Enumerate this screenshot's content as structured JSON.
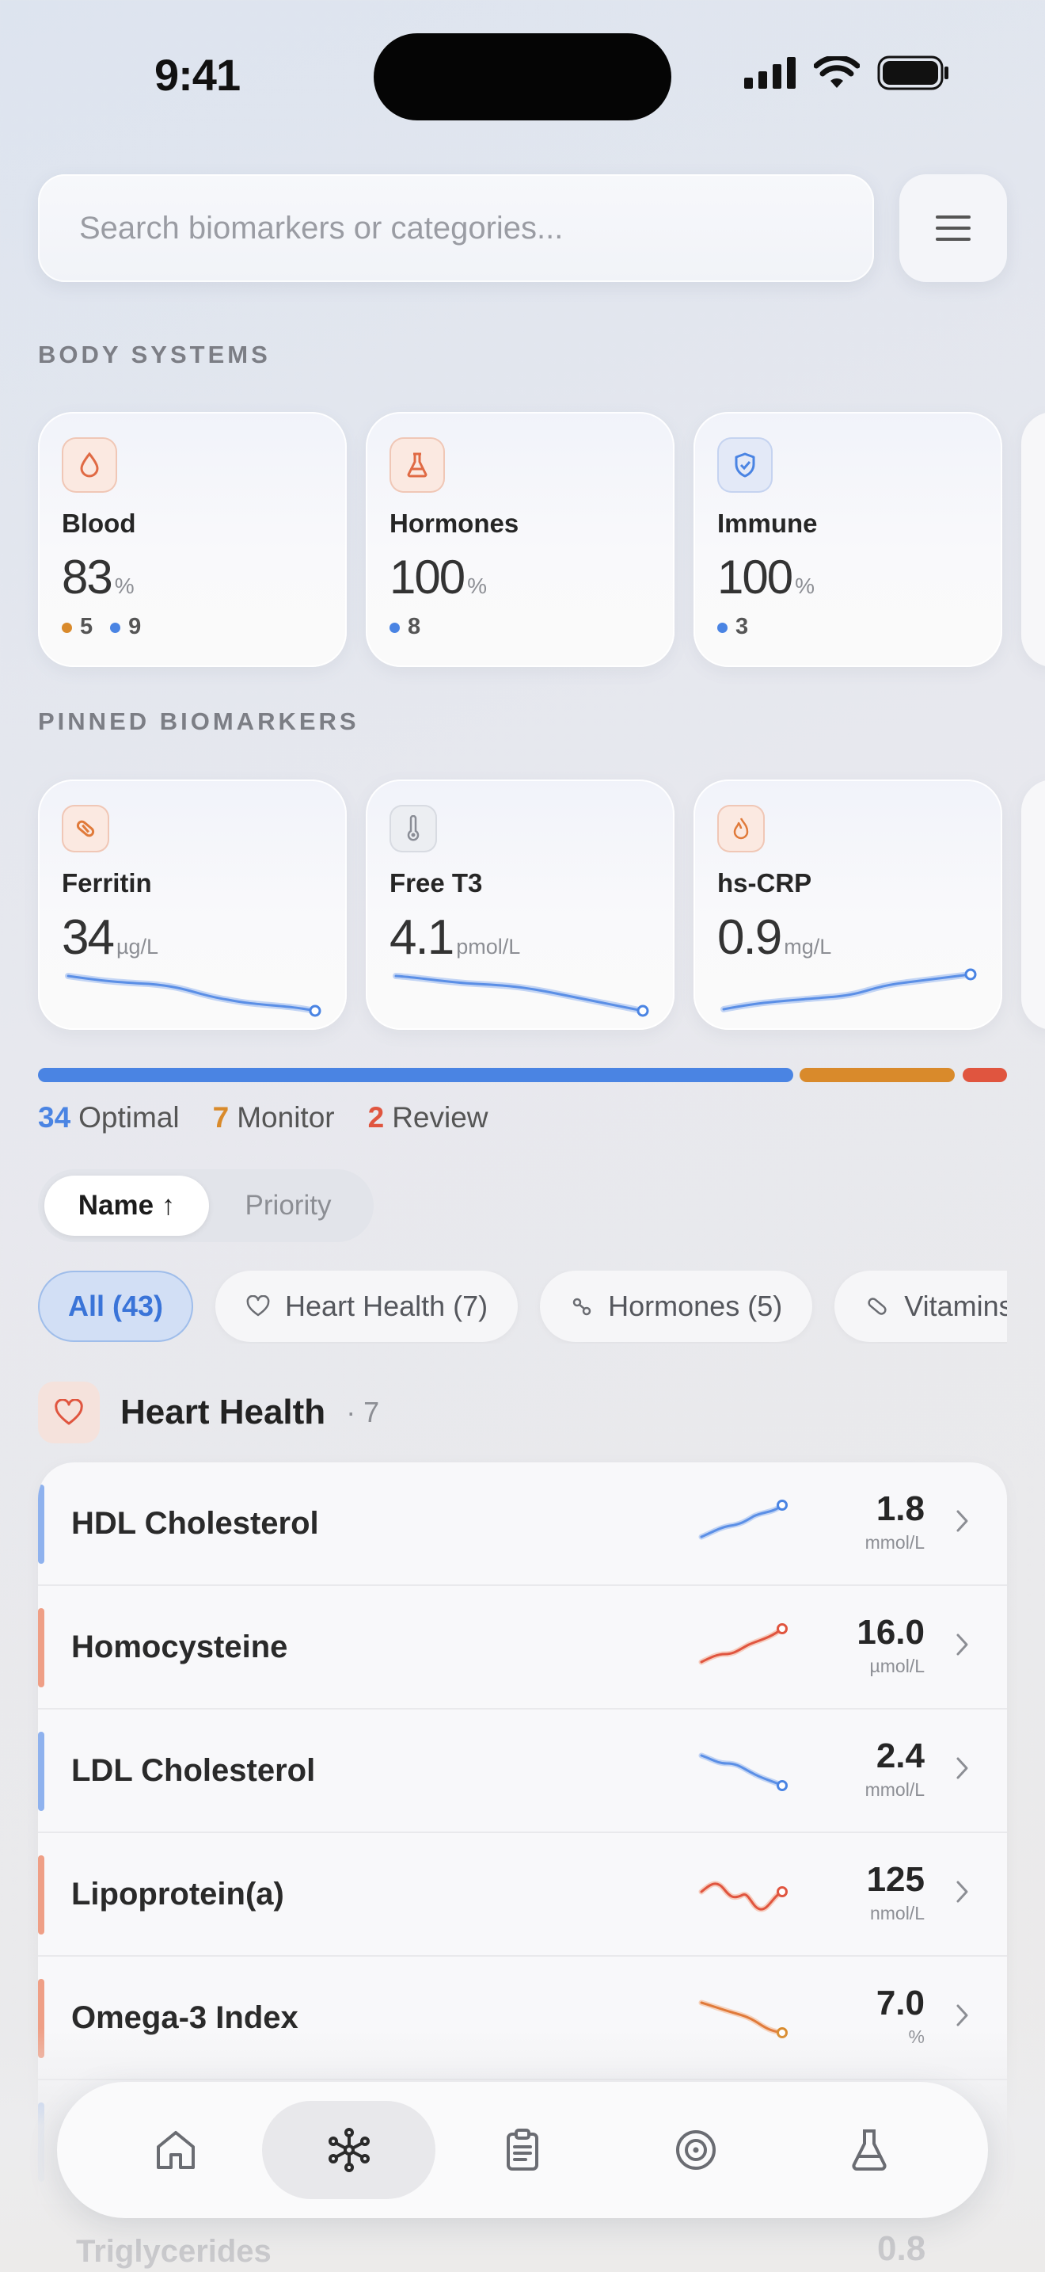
{
  "status_bar": {
    "time": "9:41"
  },
  "search": {
    "placeholder": "Search biomarkers or categories..."
  },
  "body_systems": {
    "label": "BODY SYSTEMS",
    "cards": [
      {
        "name": "Blood",
        "value": "83",
        "unit": "%",
        "icon": "drop-icon",
        "counts": [
          {
            "color": "#d98a2b",
            "value": "5"
          },
          {
            "color": "#4a84e3",
            "value": "9"
          }
        ]
      },
      {
        "name": "Hormones",
        "value": "100",
        "unit": "%",
        "icon": "flask-icon",
        "counts": [
          {
            "color": "#4a84e3",
            "value": "8"
          }
        ]
      },
      {
        "name": "Immune",
        "value": "100",
        "unit": "%",
        "icon": "shield-icon",
        "counts": [
          {
            "color": "#4a84e3",
            "value": "3"
          }
        ]
      }
    ]
  },
  "pinned": {
    "label": "PINNED BIOMARKERS",
    "cards": [
      {
        "name": "Ferritin",
        "value": "34",
        "unit": "µg/L",
        "icon": "pill-icon",
        "trend": "down"
      },
      {
        "name": "Free T3",
        "value": "4.1",
        "unit": "pmol/L",
        "icon": "thermometer-icon",
        "trend": "down"
      },
      {
        "name": "hs-CRP",
        "value": "0.9",
        "unit": "mg/L",
        "icon": "flame-icon",
        "trend": "up"
      }
    ]
  },
  "status_summary": {
    "optimal_count": "34",
    "optimal_label": "Optimal",
    "monitor_count": "7",
    "monitor_label": "Monitor",
    "review_count": "2",
    "review_label": "Review",
    "colors": {
      "optimal": "#4a84e3",
      "monitor": "#d98a2b",
      "review": "#e0553f"
    }
  },
  "sort": {
    "active": "Name ↑",
    "inactive": "Priority"
  },
  "filters": [
    {
      "label": "All (43)",
      "active": true
    },
    {
      "label": "Heart Health (7)",
      "icon": "heart-icon"
    },
    {
      "label": "Hormones (5)",
      "icon": "molecule-icon"
    },
    {
      "label": "Vitamins",
      "icon": "pill-icon"
    }
  ],
  "group": {
    "title": "Heart Health",
    "count": "· 7"
  },
  "biomarkers": [
    {
      "name": "HDL Cholesterol",
      "value": "1.8",
      "unit": "mmol/L",
      "status": "optimal"
    },
    {
      "name": "Homocysteine",
      "value": "16.0",
      "unit": "µmol/L",
      "status": "review"
    },
    {
      "name": "LDL Cholesterol",
      "value": "2.4",
      "unit": "mmol/L",
      "status": "optimal"
    },
    {
      "name": "Lipoprotein(a)",
      "value": "125",
      "unit": "nmol/L",
      "status": "review"
    },
    {
      "name": "Omega-3 Index",
      "value": "7.0",
      "unit": "%",
      "status": "monitor"
    }
  ],
  "partially_visible": {
    "name": "Triglycerides",
    "value": "0.8"
  },
  "tabs": [
    {
      "name": "home",
      "icon": "home-icon"
    },
    {
      "name": "biomarkers",
      "icon": "network-icon",
      "active": true
    },
    {
      "name": "reports",
      "icon": "clipboard-icon"
    },
    {
      "name": "goals",
      "icon": "target-icon"
    },
    {
      "name": "lab",
      "icon": "flask-icon"
    }
  ],
  "accent_colors": {
    "primary": "#4a84e3",
    "warning": "#d98a2b",
    "danger": "#e0553f"
  }
}
